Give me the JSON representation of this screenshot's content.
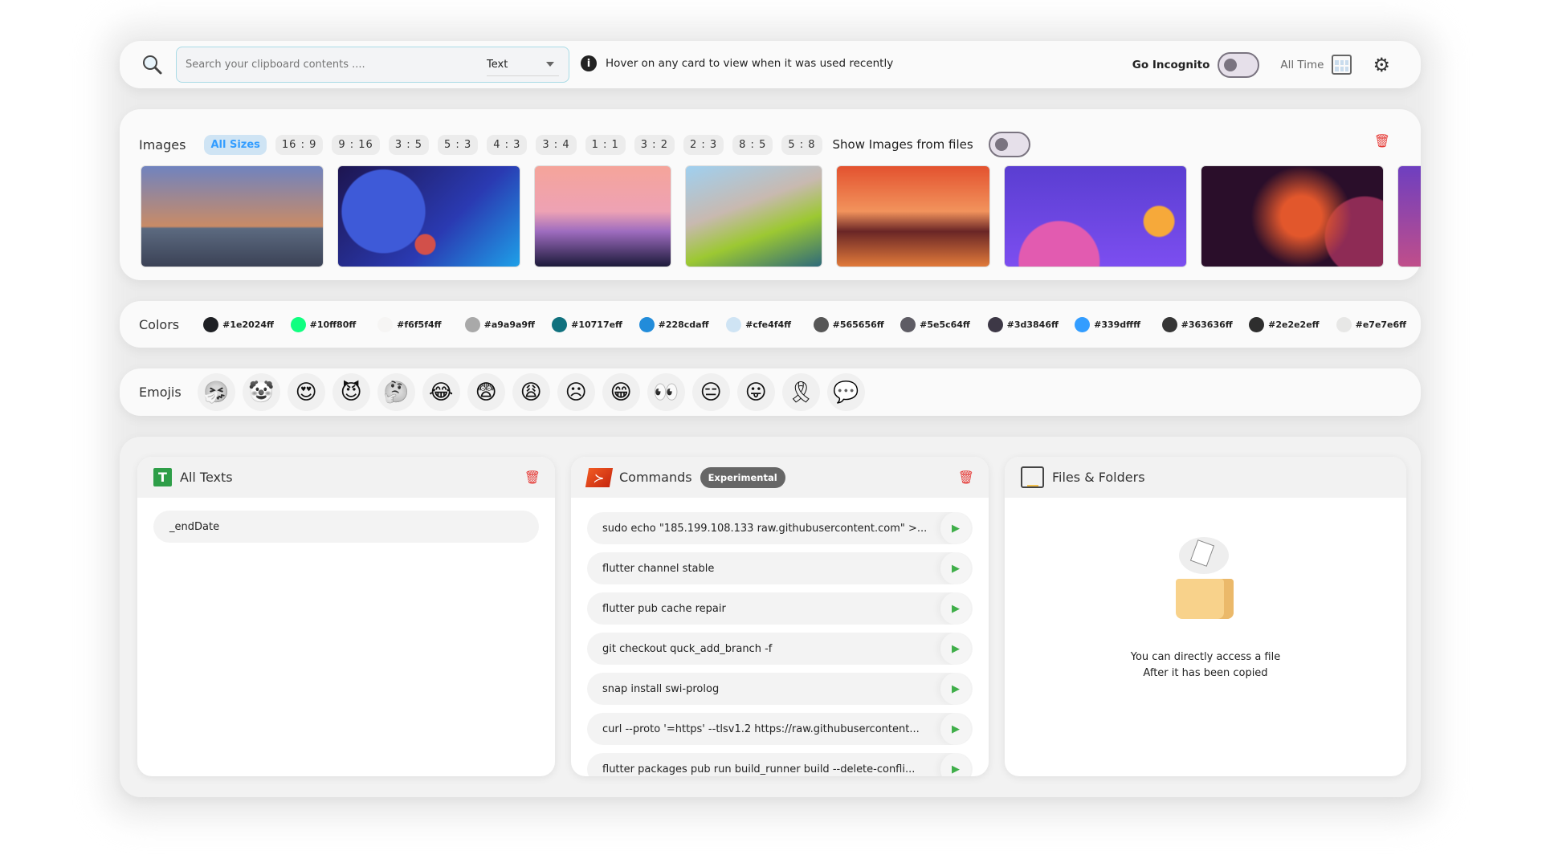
{
  "topbar": {
    "search_placeholder": "Search your clipboard contents ....",
    "type_select": "Text",
    "info": "Hover on any card to view when it was used recently",
    "incognito_label": "Go Incognito",
    "incognito_on": false,
    "time_filter": "All Time"
  },
  "images": {
    "label": "Images",
    "sizes": [
      "All Sizes",
      "16 : 9",
      "9 : 16",
      "3 : 5",
      "5 : 3",
      "4 : 3",
      "3 : 4",
      "1 : 1",
      "3 : 2",
      "2 : 3",
      "8 : 5",
      "5 : 8"
    ],
    "active_size": "All Sizes",
    "show_files_label": "Show Images from files",
    "show_files_on": false
  },
  "colors": {
    "label": "Colors",
    "items": [
      "#1e2024ff",
      "#10ff80ff",
      "#f6f5f4ff",
      "#a9a9a9ff",
      "#10717eff",
      "#228cdaff",
      "#cfe4f4ff",
      "#565656ff",
      "#5e5c64ff",
      "#3d3846ff",
      "#339dffff",
      "#363636ff",
      "#2e2e2eff",
      "#e7e7e6ff"
    ]
  },
  "emojis": {
    "label": "Emojis",
    "items": [
      "🤧",
      "🤡",
      "😍",
      "😈",
      "🤔",
      "😂",
      "😨",
      "😩",
      "☹",
      "😁",
      "👀",
      "😑",
      "😛",
      "🎗",
      "💬"
    ]
  },
  "texts": {
    "title": "All Texts",
    "items": [
      "_endDate"
    ]
  },
  "commands": {
    "title": "Commands",
    "badge": "Experimental",
    "items": [
      "sudo echo \"185.199.108.133 raw.githubusercontent.com\" >...",
      "flutter channel stable",
      "flutter pub cache repair",
      "git checkout quck_add_branch -f",
      "snap install swi-prolog",
      "curl --proto '=https' --tlsv1.2 https://raw.githubusercontent...",
      "flutter packages pub run build_runner build --delete-confli..."
    ]
  },
  "files": {
    "title": "Files & Folders",
    "empty_line1": "You can directly access a file",
    "empty_line2": "After it has been copied"
  },
  "accent": "#339dff",
  "danger": "#e53935",
  "run_color": "#3fae49"
}
